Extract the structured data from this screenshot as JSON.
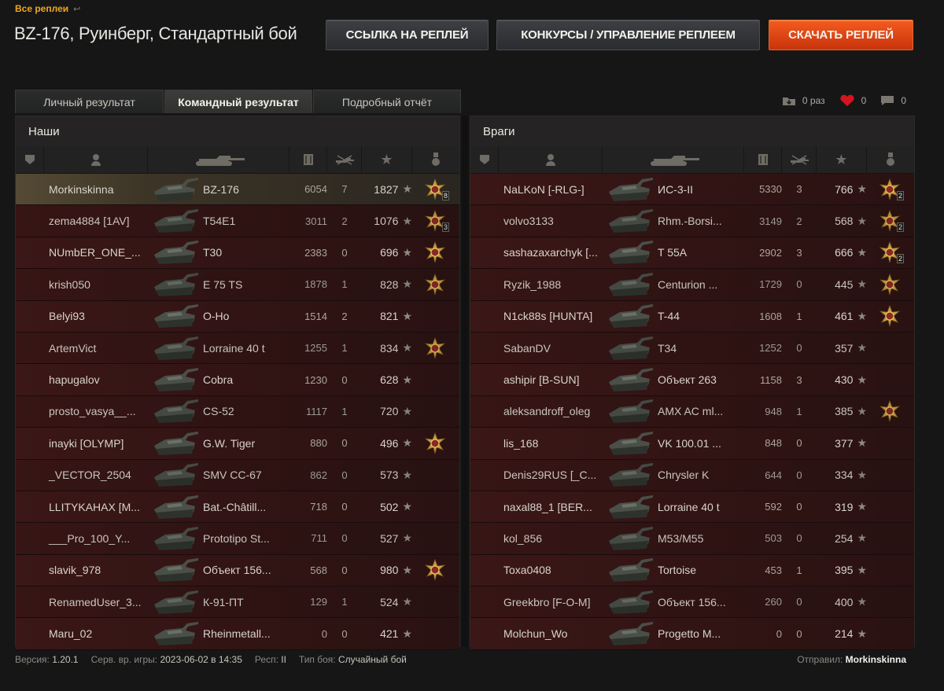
{
  "nav": {
    "all_replays": "Все реплеи"
  },
  "title": "BZ-176, Руинберг, Стандартный бой",
  "buttons": {
    "link": "ССЫЛКА НА РЕПЛЕЙ",
    "contests": "КОНКУРСЫ / УПРАВЛЕНИЕ РЕПЛЕЕМ",
    "download": "СКАЧАТЬ РЕПЛЕЙ"
  },
  "tabs": [
    {
      "label": "Личный результат"
    },
    {
      "label": "Командный результат",
      "active": true
    },
    {
      "label": "Подробный отчёт"
    }
  ],
  "stats": {
    "downloads": "0 раз",
    "likes": "0",
    "comments": "0"
  },
  "colors": {
    "accent": "#f0a81e",
    "download_btn": "#e0481a",
    "row": "#351515",
    "self_row": "#4a3f2d"
  },
  "allies": {
    "title": "Наши",
    "rows": [
      {
        "name": "Morkinskinna",
        "tank": "BZ-176",
        "dmg": "6054",
        "kills": "7",
        "xp": "1827",
        "medal": "8",
        "self": true
      },
      {
        "name": "zema4884 [1AV]",
        "tank": "T54E1",
        "dmg": "3011",
        "kills": "2",
        "xp": "1076",
        "medal": "3"
      },
      {
        "name": "NUmbER_ONE_...",
        "tank": "T30",
        "dmg": "2383",
        "kills": "0",
        "xp": "696",
        "medal": "1"
      },
      {
        "name": "krish050",
        "tank": "E 75 TS",
        "dmg": "1878",
        "kills": "1",
        "xp": "828",
        "medal": "1"
      },
      {
        "name": "Belyi93",
        "tank": "O-Ho",
        "dmg": "1514",
        "kills": "2",
        "xp": "821",
        "medal": ""
      },
      {
        "name": "ArtemVict",
        "tank": "Lorraine 40 t",
        "dmg": "1255",
        "kills": "1",
        "xp": "834",
        "medal": "1"
      },
      {
        "name": "hapugalov",
        "tank": "Cobra",
        "dmg": "1230",
        "kills": "0",
        "xp": "628",
        "medal": ""
      },
      {
        "name": "prosto_vasya__...",
        "tank": "CS-52",
        "dmg": "1117",
        "kills": "1",
        "xp": "720",
        "medal": ""
      },
      {
        "name": "inayki [OLYMP]",
        "tank": "G.W. Tiger",
        "dmg": "880",
        "kills": "0",
        "xp": "496",
        "medal": "1"
      },
      {
        "name": "_VECTOR_2504",
        "tank": "SMV CC-67",
        "dmg": "862",
        "kills": "0",
        "xp": "573",
        "medal": ""
      },
      {
        "name": "LLITYKAHAX [M...",
        "tank": "Bat.-Châtill...",
        "dmg": "718",
        "kills": "0",
        "xp": "502",
        "medal": ""
      },
      {
        "name": "___Pro_100_Y...",
        "tank": "Prototipo St...",
        "dmg": "711",
        "kills": "0",
        "xp": "527",
        "medal": ""
      },
      {
        "name": "slavik_978",
        "tank": "Объект 156...",
        "dmg": "568",
        "kills": "0",
        "xp": "980",
        "medal": "1"
      },
      {
        "name": "RenamedUser_3...",
        "tank": "К-91-ПТ",
        "dmg": "129",
        "kills": "1",
        "xp": "524",
        "medal": ""
      },
      {
        "name": "Maru_02",
        "tank": "Rheinmetall...",
        "dmg": "0",
        "kills": "0",
        "xp": "421",
        "medal": ""
      }
    ]
  },
  "enemies": {
    "title": "Враги",
    "rows": [
      {
        "name": "NaLKoN [-RLG-]",
        "tank": "ИС-3-II",
        "dmg": "5330",
        "kills": "3",
        "xp": "766",
        "medal": "2"
      },
      {
        "name": "volvo3133",
        "tank": "Rhm.-Borsi...",
        "dmg": "3149",
        "kills": "2",
        "xp": "568",
        "medal": "2"
      },
      {
        "name": "sashazaxarchyk [...",
        "tank": "T 55A",
        "dmg": "2902",
        "kills": "3",
        "xp": "666",
        "medal": "2"
      },
      {
        "name": "Ryzik_1988",
        "tank": "Centurion ...",
        "dmg": "1729",
        "kills": "0",
        "xp": "445",
        "medal": "1"
      },
      {
        "name": "N1ck88s [HUNTA]",
        "tank": "T-44",
        "dmg": "1608",
        "kills": "1",
        "xp": "461",
        "medal": "1"
      },
      {
        "name": "SabanDV",
        "tank": "T34",
        "dmg": "1252",
        "kills": "0",
        "xp": "357",
        "medal": ""
      },
      {
        "name": "ashipir [B-SUN]",
        "tank": "Объект 263",
        "dmg": "1158",
        "kills": "3",
        "xp": "430",
        "medal": ""
      },
      {
        "name": "aleksandroff_oleg",
        "tank": "AMX AC ml...",
        "dmg": "948",
        "kills": "1",
        "xp": "385",
        "medal": "1"
      },
      {
        "name": "lis_168",
        "tank": "VK 100.01 ...",
        "dmg": "848",
        "kills": "0",
        "xp": "377",
        "medal": ""
      },
      {
        "name": "Denis29RUS [_C...",
        "tank": "Chrysler K",
        "dmg": "644",
        "kills": "0",
        "xp": "334",
        "medal": ""
      },
      {
        "name": "naxal88_1 [BER...",
        "tank": "Lorraine 40 t",
        "dmg": "592",
        "kills": "0",
        "xp": "319",
        "medal": ""
      },
      {
        "name": "kol_856",
        "tank": "M53/M55",
        "dmg": "503",
        "kills": "0",
        "xp": "254",
        "medal": ""
      },
      {
        "name": "Toxa0408",
        "tank": "Tortoise",
        "dmg": "453",
        "kills": "1",
        "xp": "395",
        "medal": ""
      },
      {
        "name": "Greekbro [F-O-M]",
        "tank": "Объект 156...",
        "dmg": "260",
        "kills": "0",
        "xp": "400",
        "medal": ""
      },
      {
        "name": "Molchun_Wo",
        "tank": "Progetto M...",
        "dmg": "0",
        "kills": "0",
        "xp": "214",
        "medal": ""
      }
    ]
  },
  "footer": {
    "version_label": "Версия:",
    "version": "1.20.1",
    "server_time_label": "Серв. вр. игры:",
    "server_time": "2023-06-02 в 14:35",
    "res_label": "Респ:",
    "res": "II",
    "battle_type_label": "Тип боя:",
    "battle_type": "Случайный бой",
    "sender_label": "Отправил:",
    "sender": "Morkinskinna"
  }
}
